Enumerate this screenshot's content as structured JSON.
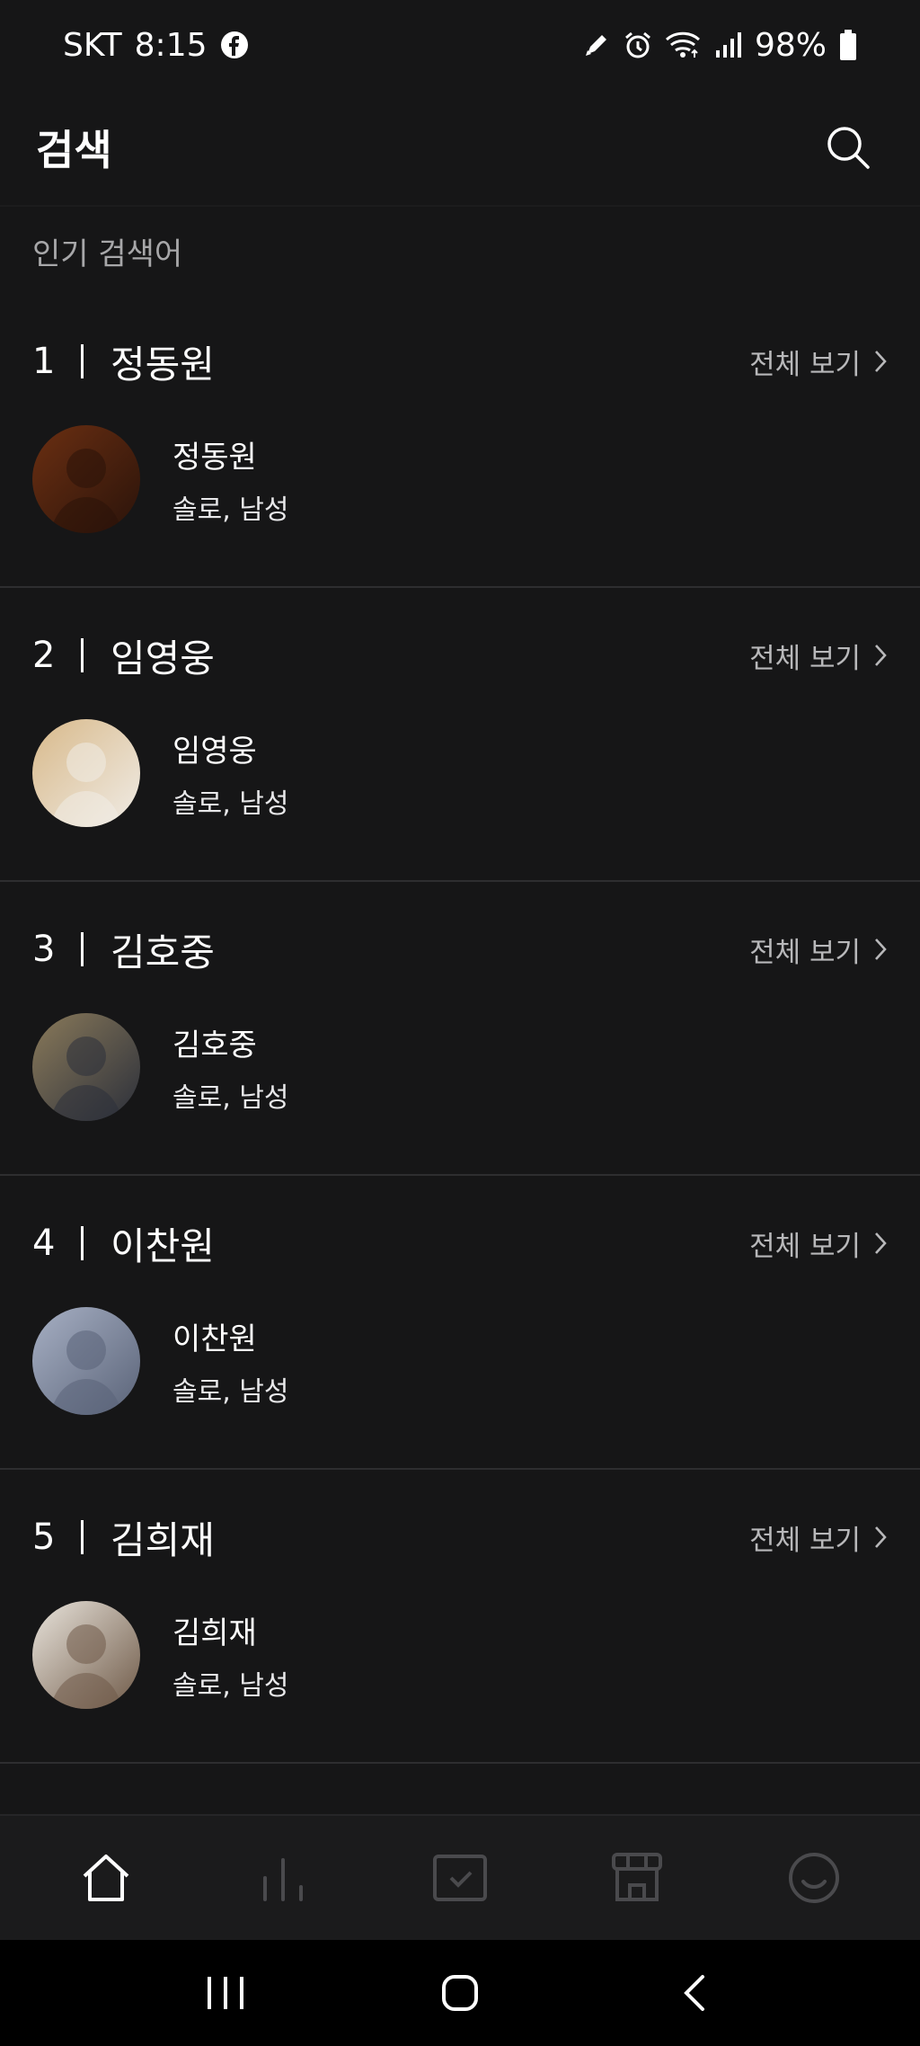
{
  "status_bar": {
    "carrier": "SKT",
    "time": "8:15",
    "battery": "98%",
    "icons": [
      "facebook-icon",
      "pen-icon",
      "alarm-icon",
      "wifi-icon",
      "signal-icon",
      "battery-icon"
    ]
  },
  "header": {
    "title": "검색",
    "search_icon": "search-icon"
  },
  "section_label": "인기 검색어",
  "view_all_label": "전체 보기",
  "rankings": [
    {
      "rank": "1",
      "name": "정동원",
      "artist_name": "정동원",
      "artist_meta": "솔로, 남성",
      "avatar_colors": [
        "#6b2f12",
        "#2a130a"
      ]
    },
    {
      "rank": "2",
      "name": "임영웅",
      "artist_name": "임영웅",
      "artist_meta": "솔로, 남성",
      "avatar_colors": [
        "#d8b98a",
        "#f0ece6"
      ]
    },
    {
      "rank": "3",
      "name": "김호중",
      "artist_name": "김호중",
      "artist_meta": "솔로, 남성",
      "avatar_colors": [
        "#8a7a5a",
        "#2b2f3a"
      ]
    },
    {
      "rank": "4",
      "name": "이찬원",
      "artist_name": "이찬원",
      "artist_meta": "솔로, 남성",
      "avatar_colors": [
        "#a7b0c4",
        "#5a6378"
      ]
    },
    {
      "rank": "5",
      "name": "김희재",
      "artist_name": "김희재",
      "artist_meta": "솔로, 남성",
      "avatar_colors": [
        "#e9e4dc",
        "#6f5a48"
      ]
    }
  ],
  "bottom_nav": {
    "items": [
      "home-icon",
      "chart-icon",
      "library-icon",
      "store-icon",
      "profile-icon"
    ],
    "active": "home-icon"
  },
  "system_nav": [
    "recent-apps-icon",
    "home-circle-icon",
    "back-icon"
  ]
}
